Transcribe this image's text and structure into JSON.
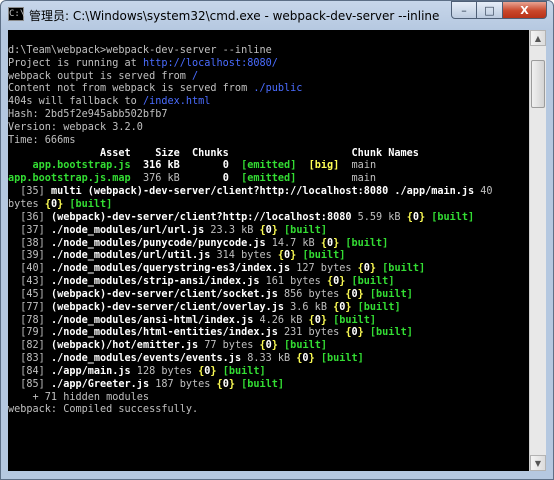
{
  "window": {
    "title": "管理员: C:\\Windows\\system32\\cmd.exe - webpack-dev-server  --inline",
    "icon_text": "C:\\",
    "controls": {
      "minimize": "–",
      "maximize": "□",
      "close": "X"
    }
  },
  "console": {
    "lines": [
      [
        {
          "t": "",
          "c": "w"
        }
      ],
      [
        {
          "t": "d:\\Team\\webpack>webpack-dev-server --inline",
          "c": "w"
        }
      ],
      [
        {
          "t": "Project is running at ",
          "c": "w"
        },
        {
          "t": "http://localhost:8080/",
          "c": "b"
        }
      ],
      [
        {
          "t": "webpack output is served from ",
          "c": "w"
        },
        {
          "t": "/",
          "c": "b"
        }
      ],
      [
        {
          "t": "Content not from webpack is served from ",
          "c": "w"
        },
        {
          "t": "./public",
          "c": "b"
        }
      ],
      [
        {
          "t": "404s will fallback to ",
          "c": "w"
        },
        {
          "t": "/index.html",
          "c": "b"
        }
      ],
      [
        {
          "t": "Hash: 2bd5f2e945abb502bfb7",
          "c": "w"
        }
      ],
      [
        {
          "t": "Version: webpack 3.2.0",
          "c": "w"
        }
      ],
      [
        {
          "t": "Time: 666ms",
          "c": "w"
        }
      ],
      [
        {
          "t": "               Asset    Size  Chunks                    Chunk Names",
          "c": "W"
        }
      ],
      [
        {
          "t": "    ",
          "c": "w"
        },
        {
          "t": "app.bootstrap.js",
          "c": "g"
        },
        {
          "t": "  316 kB       ",
          "c": "W"
        },
        {
          "t": "0",
          "c": "W"
        },
        {
          "t": "  ",
          "c": "w"
        },
        {
          "t": "[emitted]",
          "c": "g"
        },
        {
          "t": "  ",
          "c": "w"
        },
        {
          "t": "[big]",
          "c": "y"
        },
        {
          "t": "  main",
          "c": "w"
        }
      ],
      [
        {
          "t": "app.bootstrap.js.map",
          "c": "g"
        },
        {
          "t": "  376 kB       ",
          "c": "w"
        },
        {
          "t": "0",
          "c": "W"
        },
        {
          "t": "  ",
          "c": "w"
        },
        {
          "t": "[emitted]",
          "c": "g"
        },
        {
          "t": "         main",
          "c": "w"
        }
      ],
      [
        {
          "t": "  [35] ",
          "c": "w"
        },
        {
          "t": "multi (webpack)-dev-server/client?http://localhost:8080 ./app/main.js",
          "c": "W"
        },
        {
          "t": " 40",
          "c": "w"
        }
      ],
      [
        {
          "t": "bytes ",
          "c": "w"
        },
        {
          "t": "{",
          "c": "y"
        },
        {
          "t": "0",
          "c": "W"
        },
        {
          "t": "}",
          "c": "y"
        },
        {
          "t": " ",
          "c": "w"
        },
        {
          "t": "[built]",
          "c": "g"
        }
      ],
      [
        {
          "t": "  [36] ",
          "c": "w"
        },
        {
          "t": "(webpack)-dev-server/client?http://localhost:8080",
          "c": "W"
        },
        {
          "t": " 5.59 kB ",
          "c": "w"
        },
        {
          "t": "{",
          "c": "y"
        },
        {
          "t": "0",
          "c": "W"
        },
        {
          "t": "}",
          "c": "y"
        },
        {
          "t": " ",
          "c": "w"
        },
        {
          "t": "[built]",
          "c": "g"
        }
      ],
      [
        {
          "t": "  [37] ",
          "c": "w"
        },
        {
          "t": "./node_modules/url/url.js",
          "c": "W"
        },
        {
          "t": " 23.3 kB ",
          "c": "w"
        },
        {
          "t": "{",
          "c": "y"
        },
        {
          "t": "0",
          "c": "W"
        },
        {
          "t": "}",
          "c": "y"
        },
        {
          "t": " ",
          "c": "w"
        },
        {
          "t": "[built]",
          "c": "g"
        }
      ],
      [
        {
          "t": "  [38] ",
          "c": "w"
        },
        {
          "t": "./node_modules/punycode/punycode.js",
          "c": "W"
        },
        {
          "t": " 14.7 kB ",
          "c": "w"
        },
        {
          "t": "{",
          "c": "y"
        },
        {
          "t": "0",
          "c": "W"
        },
        {
          "t": "}",
          "c": "y"
        },
        {
          "t": " ",
          "c": "w"
        },
        {
          "t": "[built]",
          "c": "g"
        }
      ],
      [
        {
          "t": "  [39] ",
          "c": "w"
        },
        {
          "t": "./node_modules/url/util.js",
          "c": "W"
        },
        {
          "t": " 314 bytes ",
          "c": "w"
        },
        {
          "t": "{",
          "c": "y"
        },
        {
          "t": "0",
          "c": "W"
        },
        {
          "t": "}",
          "c": "y"
        },
        {
          "t": " ",
          "c": "w"
        },
        {
          "t": "[built]",
          "c": "g"
        }
      ],
      [
        {
          "t": "  [40] ",
          "c": "w"
        },
        {
          "t": "./node_modules/querystring-es3/index.js",
          "c": "W"
        },
        {
          "t": " 127 bytes ",
          "c": "w"
        },
        {
          "t": "{",
          "c": "y"
        },
        {
          "t": "0",
          "c": "W"
        },
        {
          "t": "}",
          "c": "y"
        },
        {
          "t": " ",
          "c": "w"
        },
        {
          "t": "[built]",
          "c": "g"
        }
      ],
      [
        {
          "t": "  [43] ",
          "c": "w"
        },
        {
          "t": "./node_modules/strip-ansi/index.js",
          "c": "W"
        },
        {
          "t": " 161 bytes ",
          "c": "w"
        },
        {
          "t": "{",
          "c": "y"
        },
        {
          "t": "0",
          "c": "W"
        },
        {
          "t": "}",
          "c": "y"
        },
        {
          "t": " ",
          "c": "w"
        },
        {
          "t": "[built]",
          "c": "g"
        }
      ],
      [
        {
          "t": "  [45] ",
          "c": "w"
        },
        {
          "t": "(webpack)-dev-server/client/socket.js",
          "c": "W"
        },
        {
          "t": " 856 bytes ",
          "c": "w"
        },
        {
          "t": "{",
          "c": "y"
        },
        {
          "t": "0",
          "c": "W"
        },
        {
          "t": "}",
          "c": "y"
        },
        {
          "t": " ",
          "c": "w"
        },
        {
          "t": "[built]",
          "c": "g"
        }
      ],
      [
        {
          "t": "  [77] ",
          "c": "w"
        },
        {
          "t": "(webpack)-dev-server/client/overlay.js",
          "c": "W"
        },
        {
          "t": " 3.6 kB ",
          "c": "w"
        },
        {
          "t": "{",
          "c": "y"
        },
        {
          "t": "0",
          "c": "W"
        },
        {
          "t": "}",
          "c": "y"
        },
        {
          "t": " ",
          "c": "w"
        },
        {
          "t": "[built]",
          "c": "g"
        }
      ],
      [
        {
          "t": "  [78] ",
          "c": "w"
        },
        {
          "t": "./node_modules/ansi-html/index.js",
          "c": "W"
        },
        {
          "t": " 4.26 kB ",
          "c": "w"
        },
        {
          "t": "{",
          "c": "y"
        },
        {
          "t": "0",
          "c": "W"
        },
        {
          "t": "}",
          "c": "y"
        },
        {
          "t": " ",
          "c": "w"
        },
        {
          "t": "[built]",
          "c": "g"
        }
      ],
      [
        {
          "t": "  [79] ",
          "c": "w"
        },
        {
          "t": "./node_modules/html-entities/index.js",
          "c": "W"
        },
        {
          "t": " 231 bytes ",
          "c": "w"
        },
        {
          "t": "{",
          "c": "y"
        },
        {
          "t": "0",
          "c": "W"
        },
        {
          "t": "}",
          "c": "y"
        },
        {
          "t": " ",
          "c": "w"
        },
        {
          "t": "[built]",
          "c": "g"
        }
      ],
      [
        {
          "t": "  [82] ",
          "c": "w"
        },
        {
          "t": "(webpack)/hot/emitter.js",
          "c": "W"
        },
        {
          "t": " 77 bytes ",
          "c": "w"
        },
        {
          "t": "{",
          "c": "y"
        },
        {
          "t": "0",
          "c": "W"
        },
        {
          "t": "}",
          "c": "y"
        },
        {
          "t": " ",
          "c": "w"
        },
        {
          "t": "[built]",
          "c": "g"
        }
      ],
      [
        {
          "t": "  [83] ",
          "c": "w"
        },
        {
          "t": "./node_modules/events/events.js",
          "c": "W"
        },
        {
          "t": " 8.33 kB ",
          "c": "w"
        },
        {
          "t": "{",
          "c": "y"
        },
        {
          "t": "0",
          "c": "W"
        },
        {
          "t": "}",
          "c": "y"
        },
        {
          "t": " ",
          "c": "w"
        },
        {
          "t": "[built]",
          "c": "g"
        }
      ],
      [
        {
          "t": "  [84] ",
          "c": "w"
        },
        {
          "t": "./app/main.js",
          "c": "W"
        },
        {
          "t": " 128 bytes ",
          "c": "w"
        },
        {
          "t": "{",
          "c": "y"
        },
        {
          "t": "0",
          "c": "W"
        },
        {
          "t": "}",
          "c": "y"
        },
        {
          "t": " ",
          "c": "w"
        },
        {
          "t": "[built]",
          "c": "g"
        }
      ],
      [
        {
          "t": "  [85] ",
          "c": "w"
        },
        {
          "t": "./app/Greeter.js",
          "c": "W"
        },
        {
          "t": " 187 bytes ",
          "c": "w"
        },
        {
          "t": "{",
          "c": "y"
        },
        {
          "t": "0",
          "c": "W"
        },
        {
          "t": "}",
          "c": "y"
        },
        {
          "t": " ",
          "c": "w"
        },
        {
          "t": "[built]",
          "c": "g"
        }
      ],
      [
        {
          "t": "    + 71 hidden modules",
          "c": "w"
        }
      ],
      [
        {
          "t": "webpack: Compiled successfully.",
          "c": "w"
        }
      ]
    ]
  },
  "colors": {
    "w": "#c0c0c0",
    "W": "#ffffff",
    "g": "#33dd33",
    "y": "#ffff55",
    "b": "#4a6cff"
  },
  "scrollbar": {
    "up_icon": "▲",
    "down_icon": "▼"
  }
}
